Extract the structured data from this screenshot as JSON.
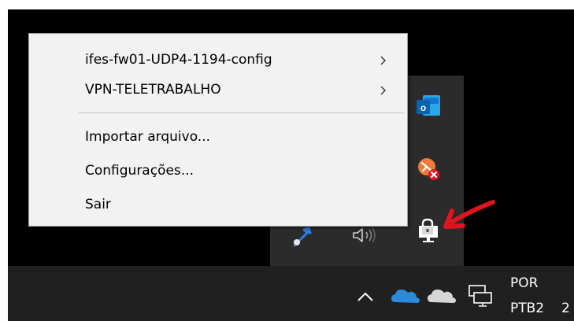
{
  "context_menu": {
    "items": [
      {
        "label": "ifes-fw01-UDP4-1194-config",
        "submenu": true
      },
      {
        "label": "VPN-TELETRABALHO",
        "submenu": true
      },
      {
        "label": "Importar arquivo...",
        "submenu": false
      },
      {
        "label": "Configurações...",
        "submenu": false
      },
      {
        "label": "Sair",
        "submenu": false
      }
    ]
  },
  "taskbar": {
    "language": {
      "line1": "POR",
      "line2": "PTB2"
    },
    "clock_partial": "2"
  },
  "colors": {
    "menu_bg": "#f2f2f2",
    "taskbar_bg": "#202020",
    "flyout_bg": "#2b2b2b",
    "annotation_arrow": "#e0141e"
  },
  "icons": {
    "flyout": [
      "outlook-icon",
      "app-error-icon",
      "bluetooth-icon",
      "volume-icon",
      "vpn-lock-icon"
    ],
    "taskbar": [
      "chevron-up-icon",
      "onedrive-blue-icon",
      "onedrive-gray-icon",
      "network-icon"
    ]
  }
}
